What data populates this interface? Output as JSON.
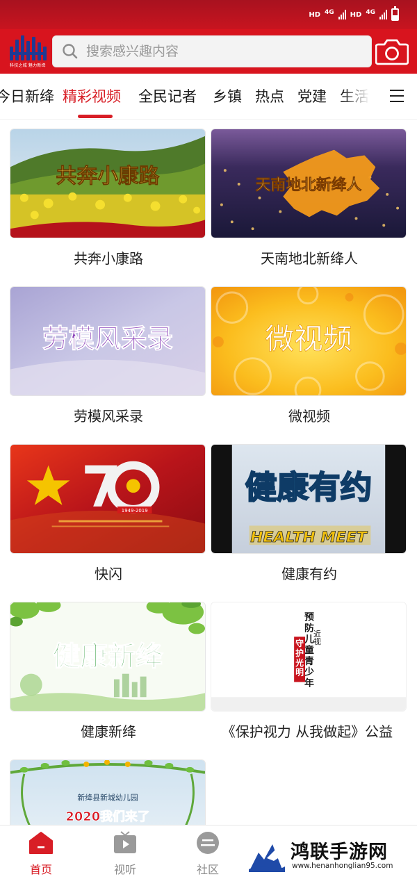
{
  "status_bar": {
    "network_1": "HD",
    "signal_1": "4G",
    "network_2": "HD",
    "signal_2": "4G"
  },
  "header": {
    "logo_text": "科技之城 魅力新绛",
    "search": {
      "placeholder": "搜索感兴趣内容"
    },
    "icons": {
      "search": "search-icon",
      "camera": "camera-icon"
    }
  },
  "tabs": {
    "items": [
      {
        "label": "今日新绛",
        "active": false
      },
      {
        "label": "精彩视频",
        "active": true
      },
      {
        "label": "全民记者",
        "active": false
      },
      {
        "label": "乡镇",
        "active": false
      },
      {
        "label": "热点",
        "active": false
      },
      {
        "label": "党建",
        "active": false
      },
      {
        "label": "生活",
        "active": false
      }
    ],
    "menu_icon": "hamburger-menu-icon"
  },
  "videos": {
    "items": [
      {
        "title": "共奔小康路",
        "thumb_text": "共奔小康路"
      },
      {
        "title": "天南地北新绛人",
        "thumb_text": "天南地北新绛人"
      },
      {
        "title": "劳模风采录",
        "thumb_text": "劳模风采录"
      },
      {
        "title": "微视频",
        "thumb_text": "微视频"
      },
      {
        "title": "快闪",
        "thumb_text": "1949-2019"
      },
      {
        "title": "健康有约",
        "thumb_text": "健康有约",
        "thumb_text_en": "HEALTH MEET"
      },
      {
        "title": "健康新绛",
        "thumb_text": "健康新绛"
      },
      {
        "title": "《保护视力 从我做起》公益",
        "thumb_text": "预防儿童青少年近视",
        "thumb_text_2": "守护光明未来"
      },
      {
        "title": "",
        "thumb_text": "新绛县新城幼儿园",
        "thumb_text_2": "2020我们来了"
      }
    ]
  },
  "bottom_nav": {
    "items": [
      {
        "label": "首页",
        "icon": "home-icon",
        "active": true
      },
      {
        "label": "视听",
        "icon": "tv-icon",
        "active": false
      },
      {
        "label": "社区",
        "icon": "community-icon",
        "active": false
      }
    ]
  },
  "watermark": {
    "name": "鸿联手游网",
    "url": "www.henanhonglian95.com"
  },
  "colors": {
    "brand_red": "#d8141e",
    "active_tab": "#d81e26"
  }
}
